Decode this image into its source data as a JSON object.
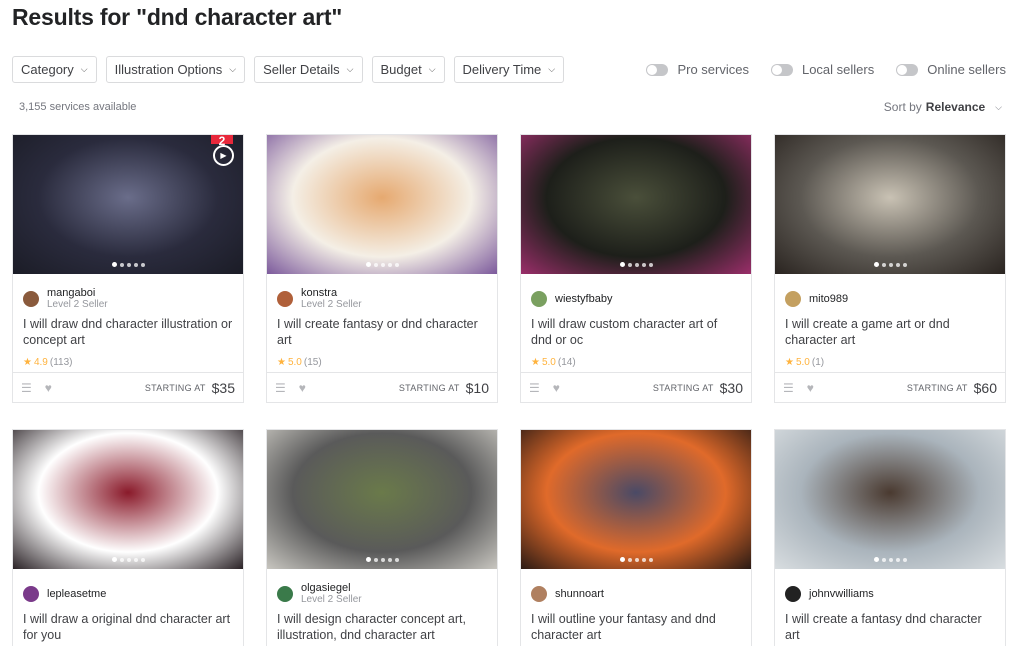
{
  "page": {
    "title": "Results for \"dnd character art\""
  },
  "filters": [
    {
      "label": "Category"
    },
    {
      "label": "Illustration Options"
    },
    {
      "label": "Seller Details"
    },
    {
      "label": "Budget"
    },
    {
      "label": "Delivery Time"
    }
  ],
  "toggles": [
    {
      "label": "Pro services"
    },
    {
      "label": "Local sellers"
    },
    {
      "label": "Online sellers"
    }
  ],
  "results": {
    "count": "3,155 services available",
    "sort_prefix": "Sort by",
    "sort_value": "Relevance"
  },
  "footer_label": "STARTING AT",
  "gigs": [
    {
      "seller": "mangaboi",
      "level": "Level 2 Seller",
      "title": "I will draw dnd character illustration or concept art",
      "rating": "4.9",
      "reviews": "(113)",
      "price": "$35",
      "badge": "2",
      "colors": [
        "#2a2b3d",
        "#6a6d8a",
        "#1b1c26"
      ],
      "avatar": "#8a5a3c"
    },
    {
      "seller": "konstra",
      "level": "Level 2 Seller",
      "title": "I will create fantasy or dnd character art",
      "rating": "5.0",
      "reviews": "(15)",
      "price": "$10",
      "colors": [
        "#f4efe6",
        "#e6a970",
        "#7c5a9c"
      ],
      "avatar": "#b0603a"
    },
    {
      "seller": "wiestyfbaby",
      "level": "",
      "title": "I will draw custom character art of dnd or oc",
      "rating": "5.0",
      "reviews": "(14)",
      "price": "$30",
      "colors": [
        "#1d1f1a",
        "#4a4f3a",
        "#9b2e6a"
      ],
      "avatar": "#7aa060"
    },
    {
      "seller": "mito989",
      "level": "",
      "title": "I will create a game art or dnd character art",
      "rating": "5.0",
      "reviews": "(1)",
      "price": "$60",
      "colors": [
        "#5c5852",
        "#c9c2b4",
        "#2a2420"
      ],
      "avatar": "#c4a060"
    },
    {
      "seller": "lepleasetme",
      "level": "",
      "title": "I will draw a original dnd character art for you",
      "rating": "",
      "reviews": "",
      "price": "",
      "colors": [
        "#ffffff",
        "#8a1a2a",
        "#2a2226"
      ],
      "avatar": "#7a3a8a"
    },
    {
      "seller": "olgasiegel",
      "level": "Level 2 Seller",
      "title": "I will design character concept art, illustration, dnd character art",
      "rating": "",
      "reviews": "",
      "price": "",
      "colors": [
        "#5a5a5a",
        "#6a7a4a",
        "#c8c6c0"
      ],
      "avatar": "#3a7a4a"
    },
    {
      "seller": "shunnoart",
      "level": "",
      "title": "I will outline your fantasy and dnd character art",
      "rating": "",
      "reviews": "",
      "price": "",
      "colors": [
        "#e06a2a",
        "#4a4a66",
        "#2a1a14"
      ],
      "avatar": "#b08060"
    },
    {
      "seller": "johnvwilliams",
      "level": "",
      "title": "I will create a fantasy dnd character art",
      "rating": "",
      "reviews": "",
      "price": "",
      "colors": [
        "#aab4bc",
        "#4a3a30",
        "#d8dde0"
      ],
      "avatar": "#222222"
    }
  ]
}
